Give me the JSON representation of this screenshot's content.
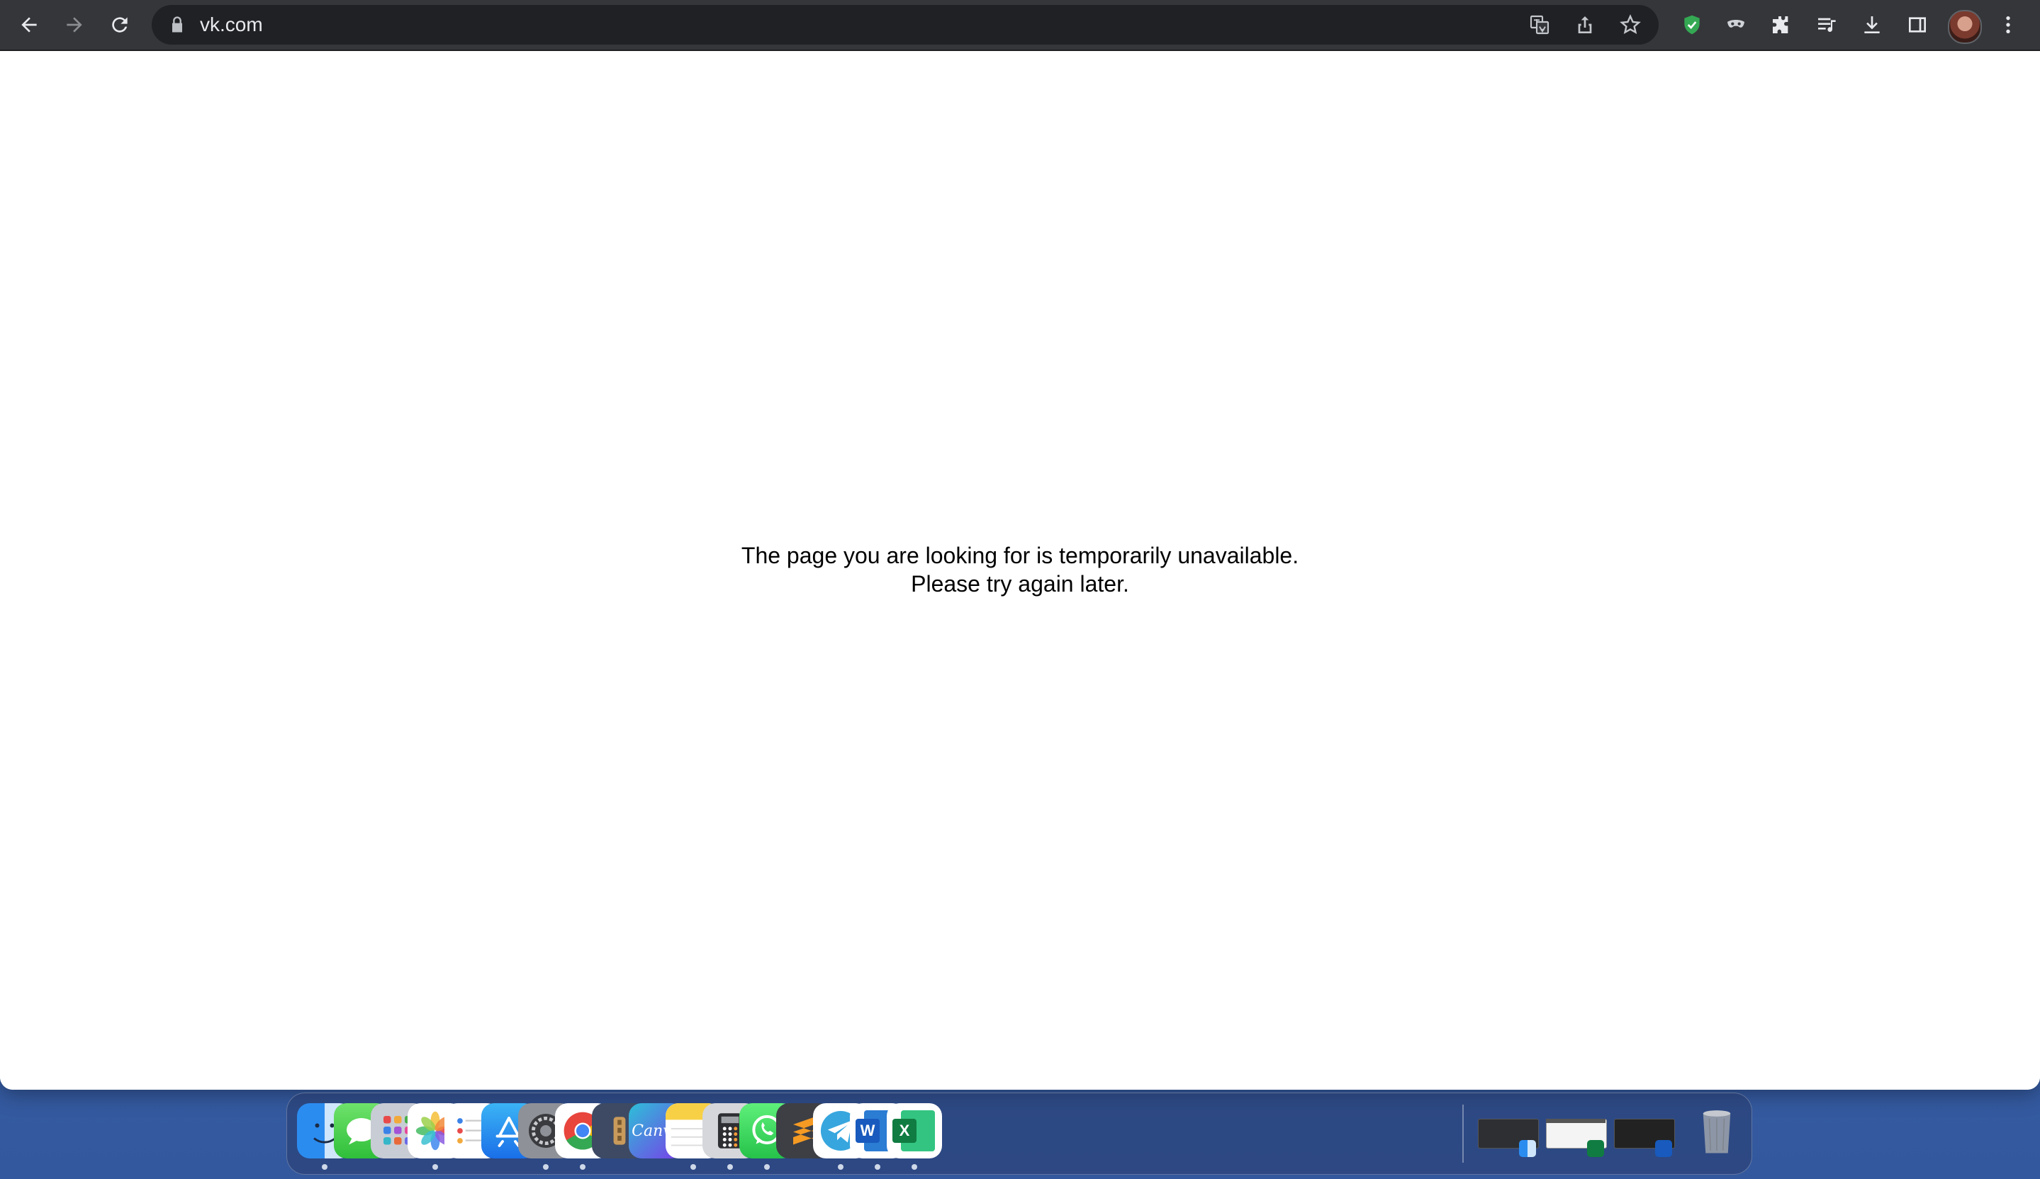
{
  "browser": {
    "url": "vk.com",
    "toolbar_icons": [
      "back-icon",
      "forward-icon",
      "reload-icon",
      "lock-icon",
      "translate-icon",
      "share-icon",
      "bookmark-star-icon",
      "shield-extension-icon",
      "mask-extension-icon",
      "extensions-puzzle-icon",
      "media-queue-icon",
      "download-icon",
      "side-panel-icon",
      "profile-avatar",
      "more-menu-icon"
    ]
  },
  "page": {
    "message_line1": "The page you are looking for is temporarily unavailable.",
    "message_line2": "Please try again later."
  },
  "dock": {
    "apps": [
      {
        "name": "Finder",
        "icon": "finder-icon",
        "running": true
      },
      {
        "name": "Messages",
        "icon": "messages-icon",
        "running": false
      },
      {
        "name": "Launchpad",
        "icon": "launchpad-icon",
        "running": false
      },
      {
        "name": "Photos",
        "icon": "photos-icon",
        "running": true
      },
      {
        "name": "Reminders",
        "icon": "reminders-icon",
        "running": false
      },
      {
        "name": "App Store",
        "icon": "app-store-icon",
        "running": false
      },
      {
        "name": "System Preferences",
        "icon": "system-preferences-icon",
        "running": true
      },
      {
        "name": "Chrome",
        "icon": "chrome-icon",
        "running": true
      },
      {
        "name": "Archive Utility",
        "icon": "archive-icon",
        "running": false
      },
      {
        "name": "Canva",
        "icon": "canva-icon",
        "label": "Canva",
        "running": false
      },
      {
        "name": "Notes",
        "icon": "notes-icon",
        "running": true
      },
      {
        "name": "Calculator",
        "icon": "calculator-icon",
        "running": true
      },
      {
        "name": "WhatsApp",
        "icon": "whatsapp-icon",
        "running": true
      },
      {
        "name": "Sublime Text",
        "icon": "sublime-text-icon",
        "running": false
      },
      {
        "name": "Telegram",
        "icon": "telegram-icon",
        "running": true
      },
      {
        "name": "Word",
        "icon": "word-icon",
        "label": "W",
        "running": true
      },
      {
        "name": "Excel",
        "icon": "excel-icon",
        "label": "X",
        "running": true
      }
    ],
    "minimized": [
      "minimized-finder-window",
      "minimized-excel-window",
      "minimized-word-window"
    ],
    "trash": "trash-icon"
  },
  "colors": {
    "toolbar": "#35363a",
    "omnibox": "#202124",
    "shield_green": "#34a853",
    "desktop_blue": "#3b66b0"
  }
}
